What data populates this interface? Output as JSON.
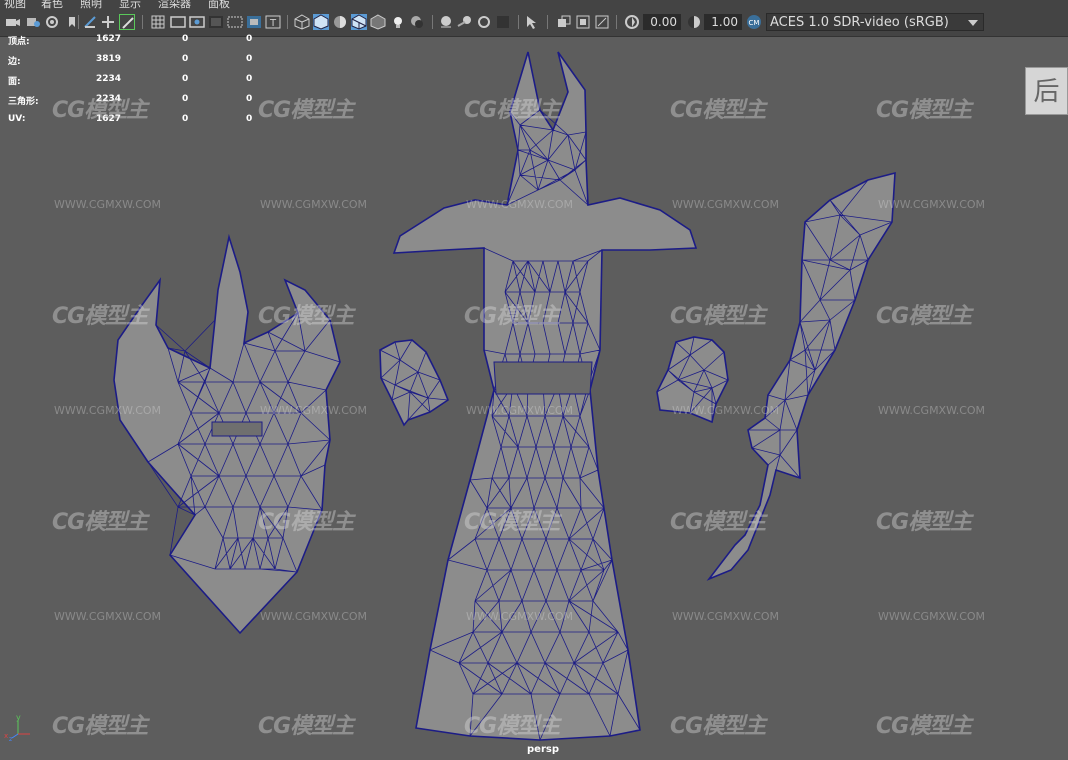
{
  "menu": [
    "视图",
    "着色",
    "照明",
    "显示",
    "渲染器",
    "面板"
  ],
  "toolbar": {
    "exposure_value": "0.00",
    "gamma_value": "1.00",
    "color_space": "ACES 1.0 SDR-video (sRGB)",
    "icons": [
      "camera-icon",
      "camera-attributes-icon",
      "bookmark-icon",
      "image-plane-icon",
      "grid-icon",
      "wireframe-icon",
      "film-gate-icon",
      "resolution-gate-icon",
      "safe-action-icon",
      "field-chart-icon",
      "shaded-icon",
      "wireframe-on-shaded-icon",
      "textured-icon",
      "lighting-icon",
      "shadows-icon",
      "ambient-occlusion-icon",
      "motion-blur-icon",
      "isolate-select-icon",
      "xray-icon",
      "exposure-icon",
      "gamma-icon",
      "color-management-icon"
    ]
  },
  "hud": [
    {
      "label": "顶点:",
      "v1": "1627",
      "v2": "0",
      "v3": "0"
    },
    {
      "label": "边:",
      "v1": "3819",
      "v2": "0",
      "v3": "0"
    },
    {
      "label": "面:",
      "v1": "2234",
      "v2": "0",
      "v3": "0"
    },
    {
      "label": "三角形:",
      "v1": "2234",
      "v2": "0",
      "v3": "0"
    },
    {
      "label": "UV:",
      "v1": "1627",
      "v2": "0",
      "v3": "0"
    }
  ],
  "viewcube_label": "后",
  "camera_name": "persp",
  "axis_labels": {
    "y": "y",
    "x": "x",
    "z": "z"
  },
  "watermark": {
    "logo": "CG模型主",
    "url": "WWW.CGMXW.COM"
  },
  "colors": {
    "wire": "#1c1c86",
    "mesh_fill": "#8c8c8c",
    "viewport_bg": "#5d5d5d",
    "toolbar_bg": "#444444"
  }
}
